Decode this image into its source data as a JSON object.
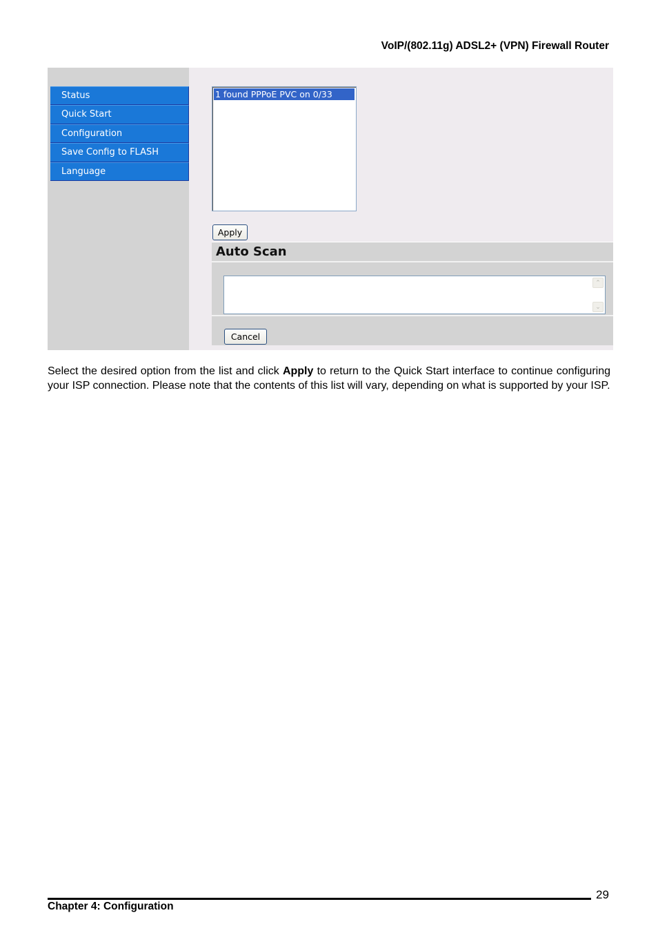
{
  "header": {
    "title": "VoIP/(802.11g) ADSL2+ (VPN) Firewall Router"
  },
  "screenshot": {
    "sidebar": {
      "items": [
        {
          "label": "Status"
        },
        {
          "label": "Quick Start"
        },
        {
          "label": "Configuration"
        },
        {
          "label": "Save Config to FLASH"
        },
        {
          "label": "Language"
        }
      ]
    },
    "pvc_list": {
      "options": [
        "1 found PPPoE PVC on 0/33"
      ],
      "selected": "1 found PPPoE PVC on 0/33"
    },
    "apply_label": "Apply",
    "auto_scan": {
      "title": "Auto Scan",
      "textarea_value": "",
      "cancel_label": "Cancel"
    },
    "colors": {
      "nav_blue": "#1a78d8",
      "selection_blue": "#3264c8",
      "panel_gray": "#d3d3d3",
      "content_bg": "#efebef"
    }
  },
  "body": {
    "text_before": "Select the desired option from the list and click ",
    "bold": "Apply",
    "text_after": " to return to the Quick Start interface to continue configuring your ISP connection. Please note that the contents of this list will vary, depending on what is supported by your ISP."
  },
  "footer": {
    "page_number": "29",
    "chapter": "Chapter 4: Configuration"
  }
}
